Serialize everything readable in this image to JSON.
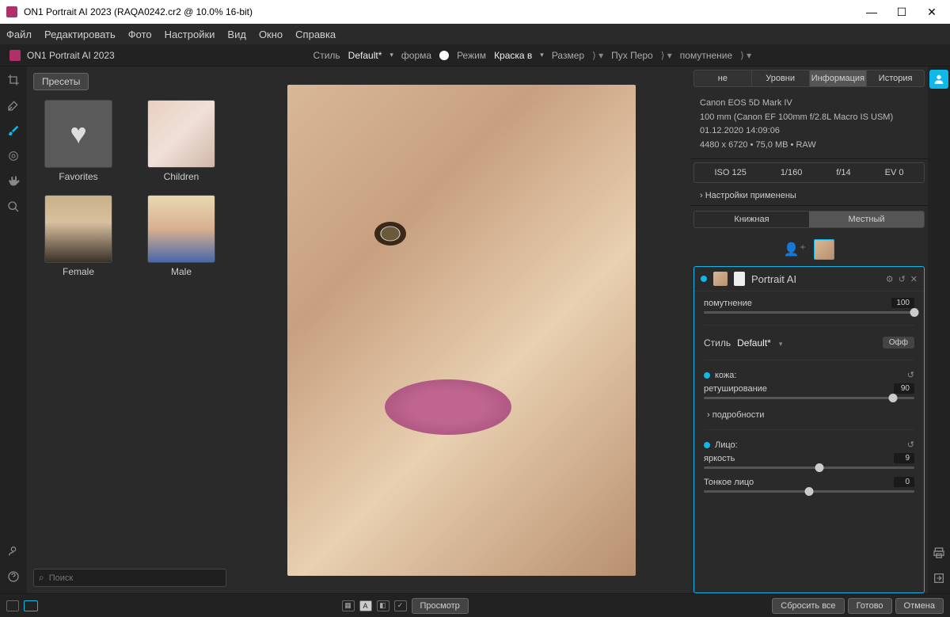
{
  "titlebar": {
    "title": "ON1 Portrait AI 2023 (RAQA0242.cr2 @ 10.0% 16-bit)"
  },
  "menubar": [
    "Файл",
    "Редактировать",
    "Фото",
    "Настройки",
    "Вид",
    "Окно",
    "Справка"
  ],
  "appbar": {
    "app_name": "ON1 Portrait AI 2023",
    "style_label": "Стиль",
    "style_value": "Default*",
    "shape_label": "форма",
    "mode_label": "Режим",
    "mode_value": "Краска в",
    "size_label": "Размер",
    "feather_label": "Пух Перо",
    "opacity_label": "помутнение"
  },
  "presets": {
    "tab_label": "Пресеты",
    "items": [
      {
        "label": "Favorites"
      },
      {
        "label": "Children"
      },
      {
        "label": "Female"
      },
      {
        "label": "Male"
      }
    ],
    "search_placeholder": "Поиск"
  },
  "info_tabs": [
    "не",
    "Уровни",
    "Информация",
    "История"
  ],
  "meta": {
    "camera": "Canon EOS 5D Mark IV",
    "lens": "100 mm (Canon EF 100mm f/2.8L Macro IS USM)",
    "date": "01.12.2020 14:09:06",
    "dims": "4480 x 6720 • 75,0 MB • RAW"
  },
  "exif": {
    "iso": "ISO 125",
    "shutter": "1/160",
    "aperture": "f/14",
    "ev": "EV 0"
  },
  "settings_applied": "Настройки применены",
  "view_toggle": {
    "book": "Книжная",
    "local": "Местный"
  },
  "portrait": {
    "title": "Portrait AI",
    "opacity_label": "помутнение",
    "opacity_value": "100",
    "style_label": "Стиль",
    "style_value": "Default*",
    "off_label": "Офф",
    "skin_label": "кожа:",
    "retouch_label": "ретуширование",
    "retouch_value": "90",
    "details_label": "подробности",
    "face_label": "Лицо:",
    "brightness_label": "яркость",
    "brightness_value": "9",
    "thin_face_label": "Тонкое лицо",
    "thin_face_value": "0"
  },
  "bottombar": {
    "preview": "Просмотр",
    "reset_all": "Сбросить все",
    "done": "Готово",
    "cancel": "Отмена"
  }
}
